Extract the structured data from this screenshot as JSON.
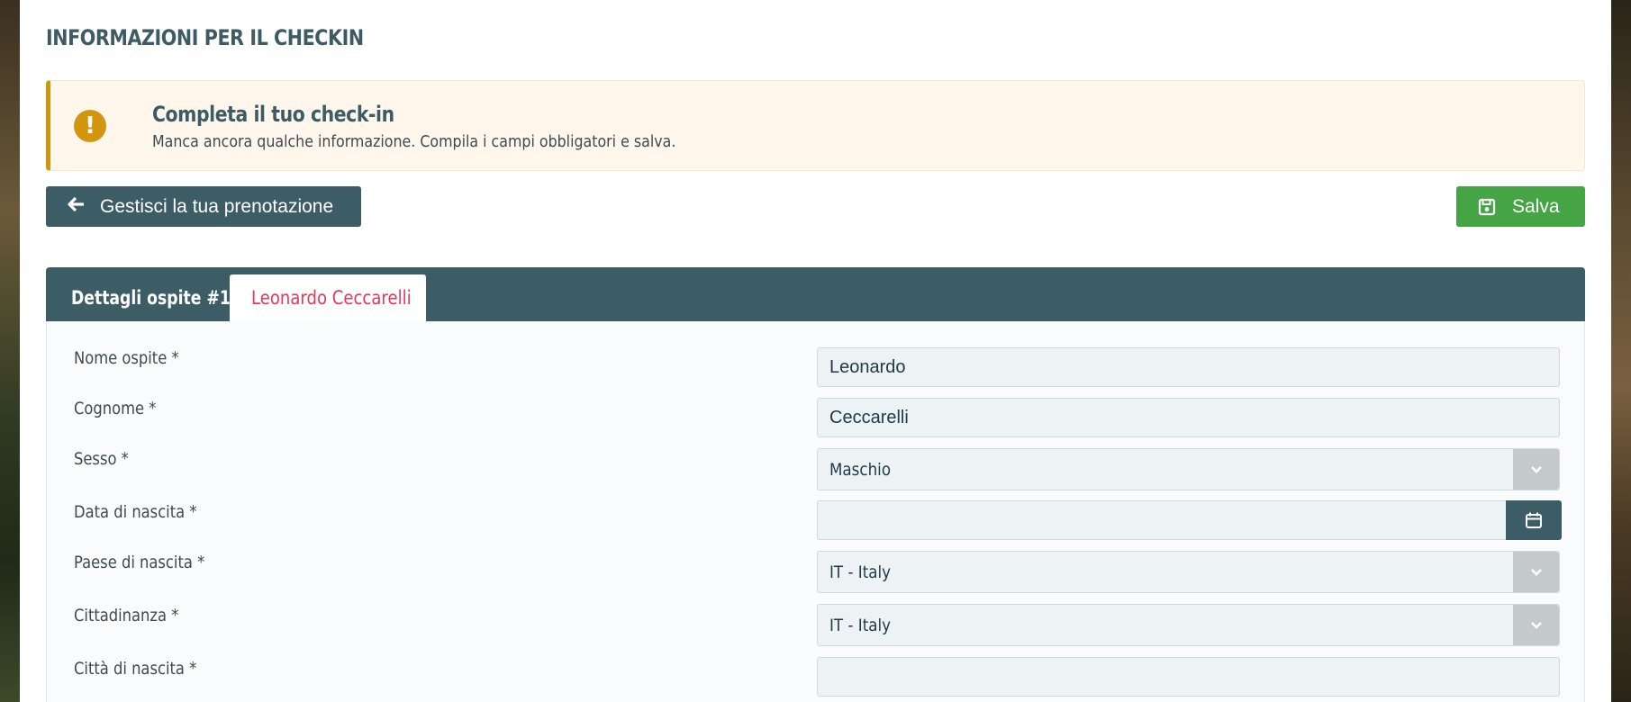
{
  "page": {
    "title": "INFORMAZIONI PER IL CHECKIN"
  },
  "alert": {
    "icon": "exclamation-icon",
    "title": "Completa il tuo check-in",
    "text": "Manca ancora qualche informazione. Compila i campi obbligatori e salva.",
    "accent": "#d2950e"
  },
  "toolbar": {
    "back_label": "Gestisci la tua prenotazione",
    "back_icon": "arrow-left-icon",
    "save_label": "Salva",
    "save_icon": "floppy-disk-icon",
    "save_color": "#45a544"
  },
  "tabs": [
    {
      "label": "Dettagli ospite #1"
    },
    {
      "label": "Leonardo Ceccarelli"
    }
  ],
  "form": {
    "nome": {
      "label": "Nome ospite *",
      "value": "Leonardo"
    },
    "cognome": {
      "label": "Cognome *",
      "value": "Ceccarelli"
    },
    "sesso": {
      "label": "Sesso *",
      "value": "Maschio"
    },
    "data_nascita": {
      "label": "Data di nascita *",
      "value": "",
      "icon": "calendar-icon"
    },
    "paese_nascita": {
      "label": "Paese di nascita *",
      "value": "IT - Italy"
    },
    "cittadinanza": {
      "label": "Cittadinanza *",
      "value": "IT - Italy"
    },
    "citta_nascita": {
      "label": "Città di nascita *",
      "value": ""
    }
  },
  "colors": {
    "primary": "#3d5d66",
    "active_tab_text": "#e23a5a"
  }
}
